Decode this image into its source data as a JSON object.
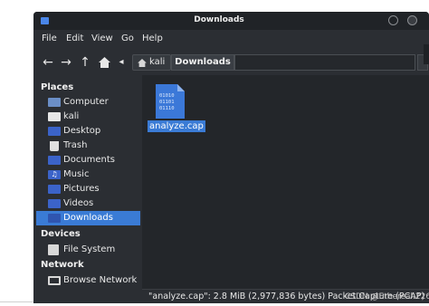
{
  "window": {
    "title": "Downloads"
  },
  "menubar": {
    "items": [
      "File",
      "Edit",
      "View",
      "Go",
      "Help"
    ]
  },
  "toolbar": {
    "breadcrumb_home": "kali",
    "breadcrumb_current": "Downloads"
  },
  "sidebar": {
    "places_heading": "Places",
    "places": [
      {
        "label": "Computer",
        "icon": "computer-icon",
        "selected": false
      },
      {
        "label": "kali",
        "icon": "home-folder-icon",
        "selected": false
      },
      {
        "label": "Desktop",
        "icon": "desktop-folder-icon",
        "selected": false
      },
      {
        "label": "Trash",
        "icon": "trash-icon",
        "selected": false
      },
      {
        "label": "Documents",
        "icon": "documents-folder-icon",
        "selected": false
      },
      {
        "label": "Music",
        "icon": "music-folder-icon",
        "selected": false
      },
      {
        "label": "Pictures",
        "icon": "pictures-folder-icon",
        "selected": false
      },
      {
        "label": "Videos",
        "icon": "videos-folder-icon",
        "selected": false
      },
      {
        "label": "Downloads",
        "icon": "downloads-folder-icon",
        "selected": true
      }
    ],
    "devices_heading": "Devices",
    "devices": [
      {
        "label": "File System",
        "icon": "drive-icon"
      }
    ],
    "network_heading": "Network",
    "network": [
      {
        "label": "Browse Network",
        "icon": "network-icon"
      }
    ]
  },
  "main": {
    "files": [
      {
        "name": "analyze.cap",
        "icon": "binary-file-icon",
        "icon_text": [
          "01010",
          "01101",
          "01110"
        ],
        "selected": true
      }
    ]
  },
  "statusbar": {
    "text": "\"analyze.cap\": 2.8 MiB (2,977,836 bytes) Packet Capture (PCAP)"
  },
  "watermark": "CSDN @Ethereal.226",
  "colors": {
    "accent": "#3a7bd5",
    "window_bg": "#2b2e33",
    "titlebar_bg": "#202327",
    "content_bg": "#23262a"
  }
}
